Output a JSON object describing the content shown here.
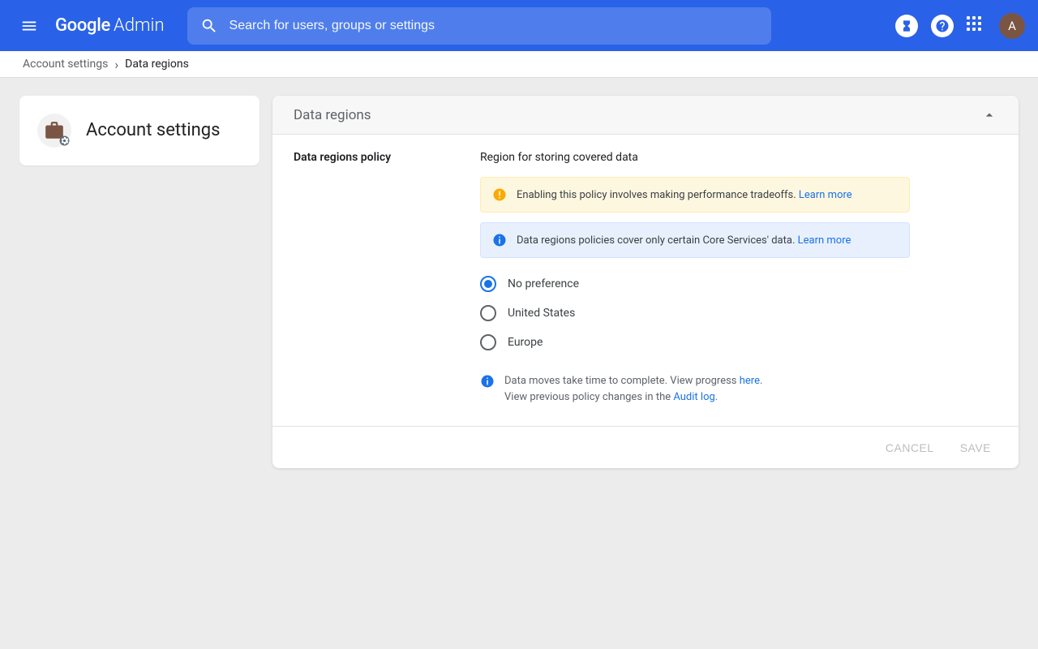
{
  "header": {
    "logo_main": "Google",
    "logo_sub": "Admin",
    "search_placeholder": "Search for users, groups or settings",
    "avatar_initial": "A"
  },
  "breadcrumb": {
    "parent": "Account settings",
    "current": "Data regions"
  },
  "sidebar": {
    "title": "Account settings"
  },
  "panel": {
    "title": "Data regions",
    "section_label": "Data regions policy",
    "subtitle": "Region for storing covered data",
    "alert_warning_text": "Enabling this policy involves making performance tradeoffs. ",
    "alert_warning_link": "Learn more",
    "alert_info_text": "Data regions policies cover only certain Core Services' data. ",
    "alert_info_link": "Learn more",
    "radios": [
      {
        "label": "No preference",
        "selected": true
      },
      {
        "label": "United States",
        "selected": false
      },
      {
        "label": "Europe",
        "selected": false
      }
    ],
    "note_line1_a": "Data moves take time to complete. View progress ",
    "note_line1_link": "here",
    "note_line1_b": ".",
    "note_line2_a": "View previous policy changes in the ",
    "note_line2_link": "Audit log",
    "note_line2_b": ".",
    "cancel_label": "CANCEL",
    "save_label": "SAVE"
  }
}
